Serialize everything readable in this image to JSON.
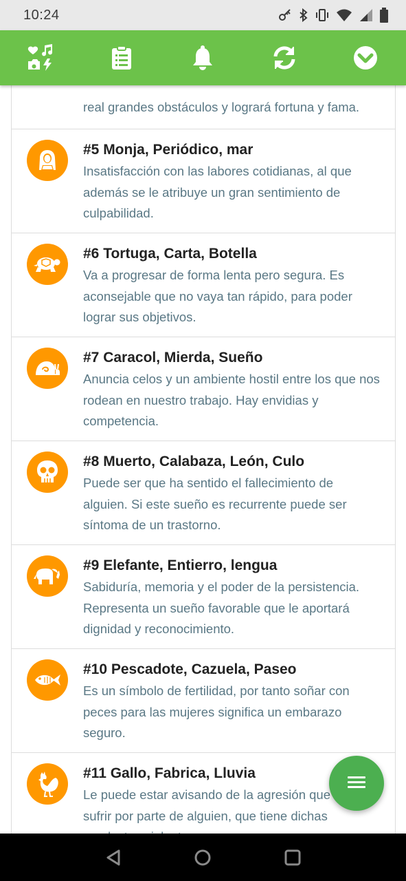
{
  "status_bar": {
    "time": "10:24",
    "icons": [
      "key-icon",
      "bluetooth-icon",
      "vibrate-icon",
      "wifi-icon",
      "signal-icon",
      "battery-icon"
    ]
  },
  "toolbar": {
    "background": "#6cc24a",
    "buttons": [
      "dream-icons-icon",
      "clipboard-list-icon",
      "bell-icon",
      "refresh-icon",
      "chevron-down-circle-icon"
    ]
  },
  "list": {
    "accent": "#ff9800",
    "items": [
      {
        "title": "",
        "description": "real grandes obstáculos y logrará fortuna y fama.",
        "icon": ""
      },
      {
        "title": "#5 Monja, Periódico, mar",
        "description": "Insatisfacción con las labores cotidianas, al que además se le atribuye un gran sentimiento de culpabilidad.",
        "icon": "nun-icon"
      },
      {
        "title": "#6 Tortuga, Carta, Botella",
        "description": "Va a progresar de forma lenta pero segura. Es aconsejable que no vaya tan rápido, para poder lograr sus objetivos.",
        "icon": "turtle-icon"
      },
      {
        "title": "#7 Caracol, Mierda, Sueño",
        "description": "Anuncia celos y un ambiente hostil entre los que nos rodean en nuestro trabajo. Hay envidias y competencia.",
        "icon": "snail-icon"
      },
      {
        "title": "#8 Muerto, Calabaza, León, Culo",
        "description": "Puede ser que ha sentido el fallecimiento de alguien. Si este sueño es recurrente puede ser síntoma de un trastorno.",
        "icon": "skull-icon"
      },
      {
        "title": "#9 Elefante, Entierro, lengua",
        "description": "Sabiduría, memoria y el poder de la persistencia. Representa un sueño favorable que le aportará dignidad y reconocimiento.",
        "icon": "elephant-icon"
      },
      {
        "title": "#10 Pescadote, Cazuela, Paseo",
        "description": "Es un símbolo de fertilidad, por tanto soñar con peces para las mujeres significa un embarazo seguro.",
        "icon": "fish-icon"
      },
      {
        "title": "#11 Gallo, Fabrica, Lluvia",
        "description": "Le puede estar avisando de la agresión que va a sufrir por parte de alguien, que tiene dichas conductas violentas.",
        "icon": "rooster-icon"
      }
    ]
  },
  "fab": {
    "icon": "menu-icon",
    "color": "#4caf50"
  },
  "nav_bar": {
    "buttons": [
      "back-icon",
      "home-icon",
      "recents-icon"
    ]
  }
}
